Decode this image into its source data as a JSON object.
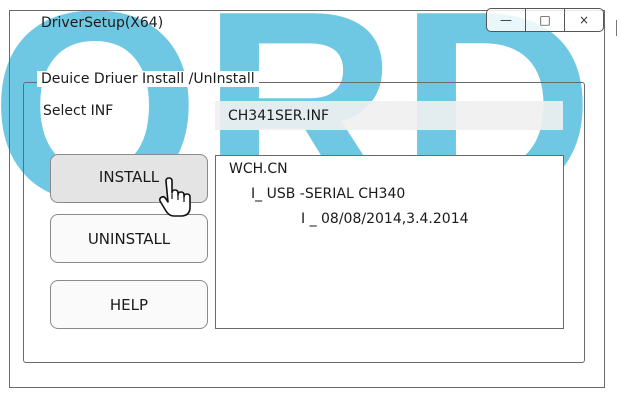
{
  "watermark": {
    "text": "ORD",
    "color": "#39b4d9"
  },
  "window": {
    "title": "DriverSetup(X64)",
    "controls": {
      "minimize": "—",
      "maximize": "□",
      "close": "×"
    }
  },
  "group": {
    "legend": "Deuice Driuer  Install /UnInstall",
    "select_label": "Select INF",
    "inf_value": "CH341SER.INF"
  },
  "buttons": {
    "install": "INSTALL",
    "uninstall": "UNINSTALL",
    "help": "HELP"
  },
  "info": {
    "lines": [
      "WCH.CN",
      "I_ USB -SERIAL CH340",
      "I _ 08/08/2014,3.4.2014"
    ]
  },
  "cursor_icon": "hand-pointer-icon"
}
